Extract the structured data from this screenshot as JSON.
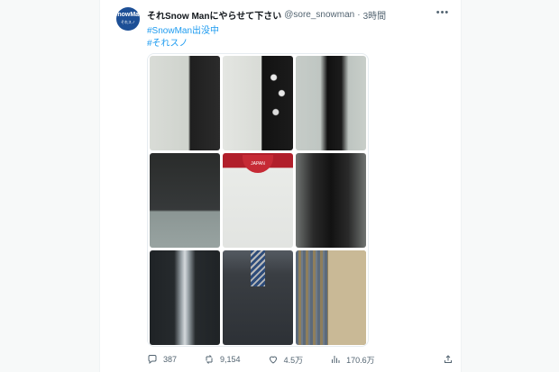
{
  "tweet": {
    "avatar": {
      "line1": "SnowMan",
      "line2": "それスノ"
    },
    "display_name": "それSnow Manにやらせて下さい",
    "handle": "@sore_snowman",
    "separator": "·",
    "time": "3時間",
    "hashtags": [
      "#SnowMan出没中",
      "#それスノ"
    ],
    "actions": {
      "replies": "387",
      "retweets": "9,154",
      "likes": "4.5万",
      "views": "170.6万"
    },
    "media": {
      "logo_text": "JAPAN"
    }
  },
  "colors": {
    "link": "#1d9bf0",
    "secondary_text": "#536471",
    "avatar_bg": "#1d4f96"
  },
  "icons": [
    "more-horizontal-icon",
    "reply-icon",
    "retweet-icon",
    "like-icon",
    "views-icon",
    "share-icon"
  ]
}
